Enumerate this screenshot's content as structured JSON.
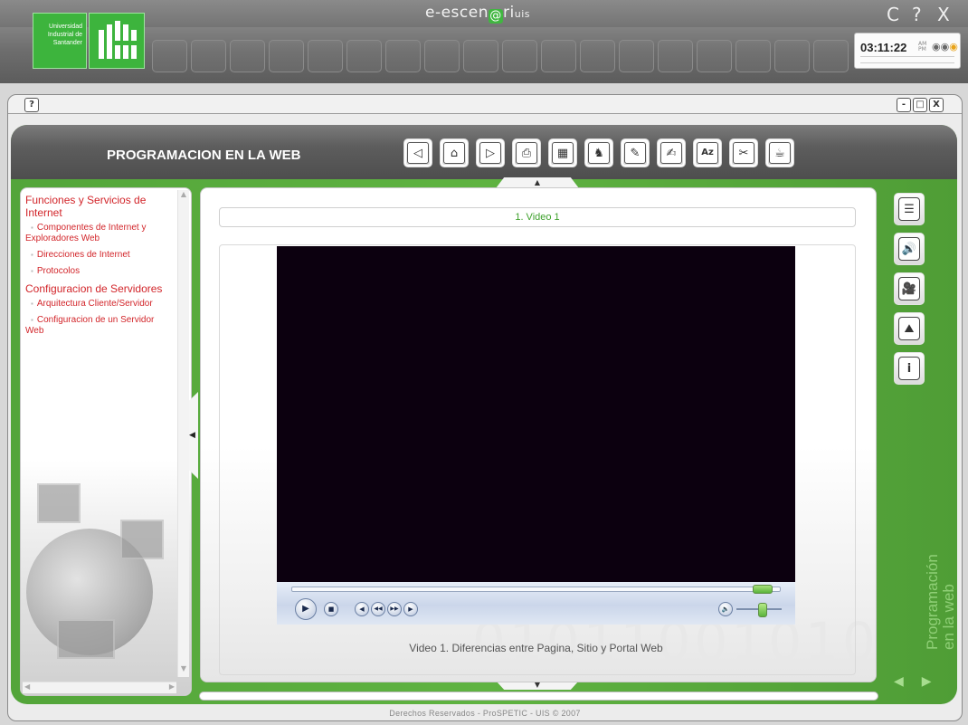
{
  "header": {
    "university_lines": [
      "Universidad",
      "Industrial de",
      "Santander"
    ],
    "brand": "e-escen",
    "brand_at": "@",
    "brand_ri": "ri",
    "brand_uis": "uis",
    "minimize": "C",
    "help": "?",
    "close": "X",
    "clock_time": "03:11:22",
    "clock_am": "AM",
    "clock_pm": "PM"
  },
  "window": {
    "help_btn": "?",
    "min_btn": "-",
    "max_btn": "□",
    "close_btn": "X",
    "footer": "Derechos Reservados - ProSPETIC - UIS © 2007"
  },
  "course": {
    "title": "PROGRAMACION EN LA WEB",
    "side_brand_line1": "Programación",
    "side_brand_line2": "en la web"
  },
  "toolbar": [
    {
      "icon": "back-arrow-icon",
      "glyph": "◁"
    },
    {
      "icon": "home-icon",
      "glyph": "⌂"
    },
    {
      "icon": "forward-arrow-icon",
      "glyph": "▷"
    },
    {
      "icon": "print-icon",
      "glyph": "⎙"
    },
    {
      "icon": "calculator-icon",
      "glyph": "▦"
    },
    {
      "icon": "people-icon",
      "glyph": "♞"
    },
    {
      "icon": "notebook-icon",
      "glyph": "✎"
    },
    {
      "icon": "edit-icon",
      "glyph": "✍"
    },
    {
      "icon": "glossary-az-icon",
      "glyph": "Az"
    },
    {
      "icon": "tools-icon",
      "glyph": "✂"
    },
    {
      "icon": "coffee-cup-icon",
      "glyph": "☕"
    }
  ],
  "sidebar": {
    "sections": [
      {
        "title": "Funciones y Servicios de Internet",
        "items": [
          "Componentes de Internet y Exploradores Web",
          "Direcciones de Internet",
          "Protocolos"
        ]
      },
      {
        "title": "Configuracion de Servidores",
        "items": [
          "Arquitectura Cliente/Servidor",
          "Configuracion de un Servidor Web"
        ]
      }
    ]
  },
  "main": {
    "video_title": "1. Video 1",
    "caption": "Video 1. Diferencias entre Pagina, Sitio y Portal Web",
    "background_digits": "01011001010"
  },
  "player": {
    "play": "▶",
    "stop": "■",
    "prev": "◀",
    "rewind": "◀◀",
    "fastforward": "▶▶",
    "next": "▶",
    "volume": "🔈"
  },
  "rail": [
    {
      "icon": "document-icon",
      "glyph": "☰"
    },
    {
      "icon": "audio-icon",
      "glyph": "🔊"
    },
    {
      "icon": "video-camera-icon",
      "glyph": "🎥"
    },
    {
      "icon": "image-icon",
      "glyph": "⛰"
    },
    {
      "icon": "info-icon",
      "glyph": "i"
    }
  ],
  "nav": {
    "prev": "◀",
    "next": "▶"
  }
}
